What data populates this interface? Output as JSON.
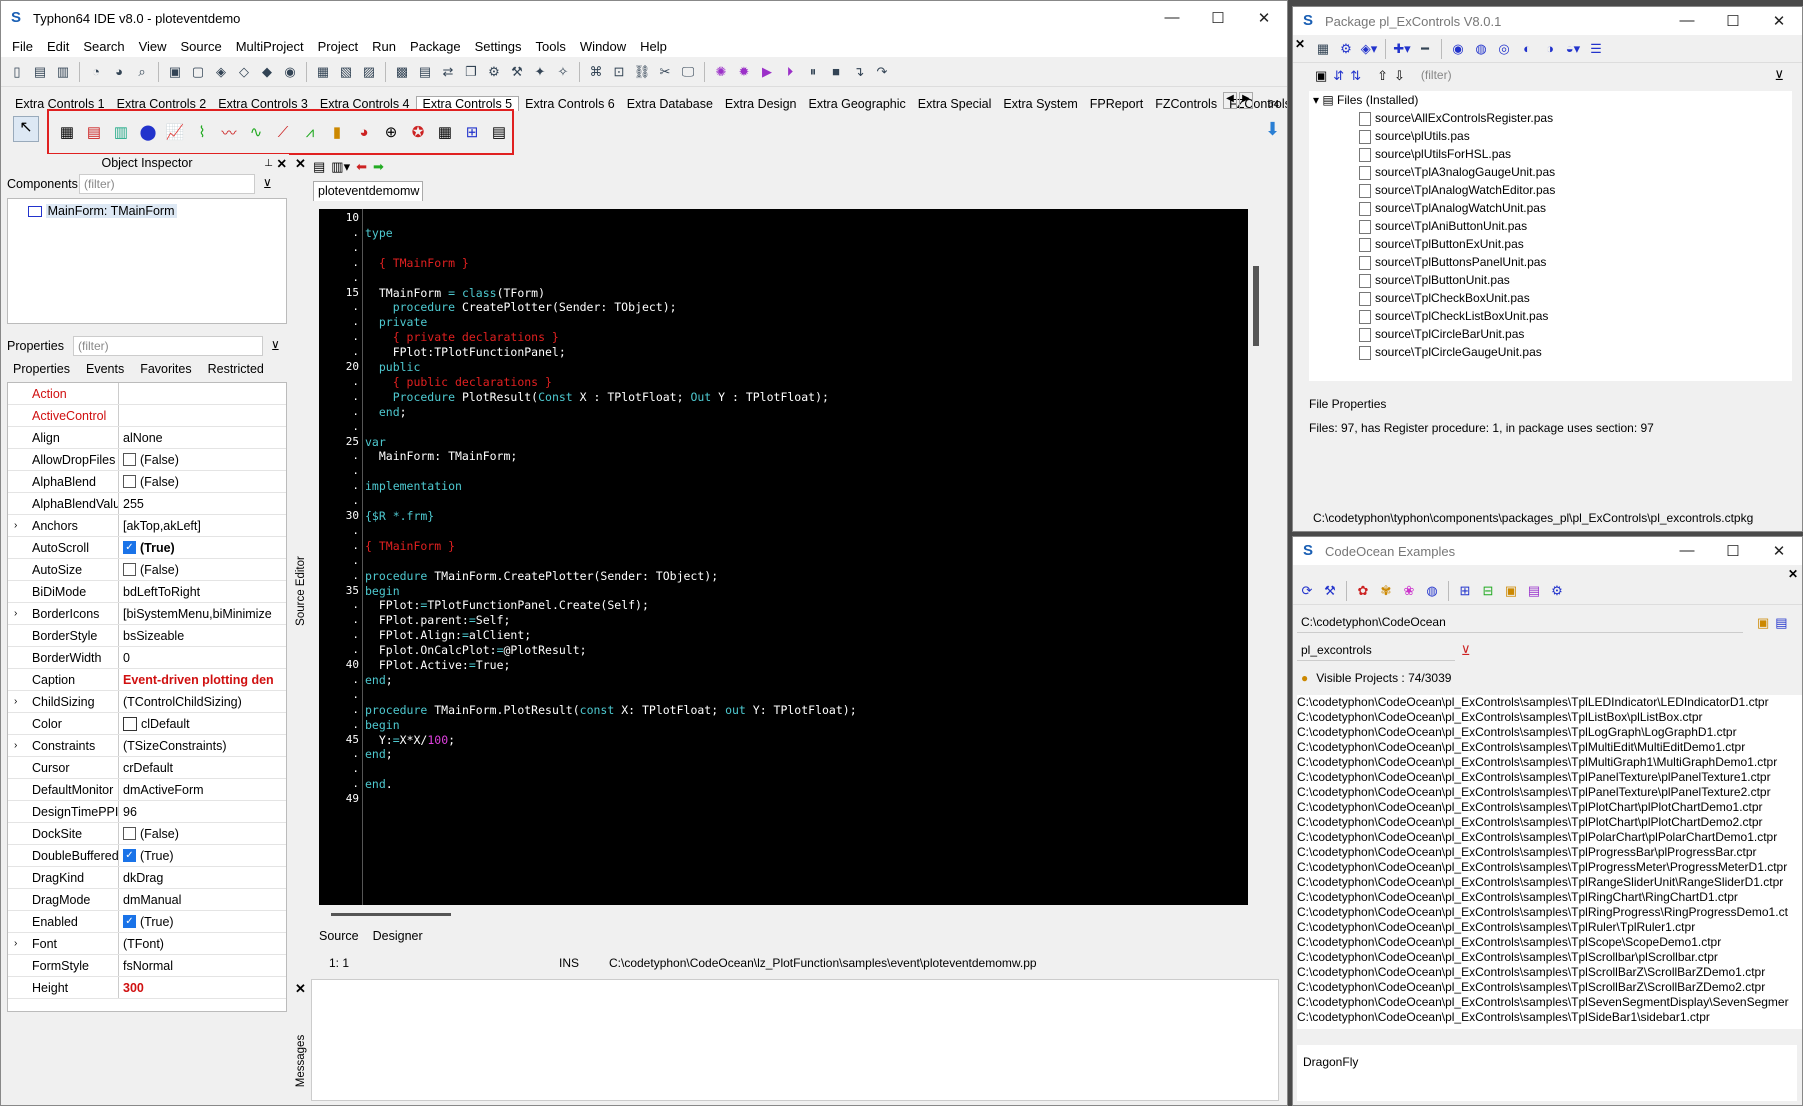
{
  "ide": {
    "title": "Typhon64 IDE v8.0 - ploteventdemo",
    "menu": [
      "File",
      "Edit",
      "Search",
      "View",
      "Source",
      "MultiProject",
      "Project",
      "Run",
      "Package",
      "Settings",
      "Tools",
      "Window",
      "Help"
    ],
    "palette_tabs": [
      "Extra Controls 1",
      "Extra Controls 2",
      "Extra Controls 3",
      "Extra Controls 4",
      "Extra Controls 5",
      "Extra Controls 6",
      "Extra Database",
      "Extra Design",
      "Extra Geographic",
      "Extra Special",
      "Extra System",
      "FPReport",
      "FZControls",
      "FZControls DB"
    ],
    "active_tab": "Extra Controls 5",
    "palette_count": "64"
  },
  "inspector": {
    "title": "Object Inspector",
    "components_label": "Components",
    "filter_placeholder": "(filter)",
    "tree_item": "MainForm: TMainForm",
    "properties_label": "Properties",
    "tabs": [
      "Properties",
      "Events",
      "Favorites",
      "Restricted"
    ],
    "rows": [
      {
        "name": "Action",
        "value": "",
        "red": true
      },
      {
        "name": "ActiveControl",
        "value": "",
        "red": true
      },
      {
        "name": "Align",
        "value": "alNone"
      },
      {
        "name": "AllowDropFiles",
        "value": "(False)",
        "chk": "off"
      },
      {
        "name": "AlphaBlend",
        "value": "(False)",
        "chk": "off"
      },
      {
        "name": "AlphaBlendValu",
        "value": "255"
      },
      {
        "name": "Anchors",
        "value": "[akTop,akLeft]",
        "exp": true
      },
      {
        "name": "AutoScroll",
        "value": "(True)",
        "chk": "on",
        "bold": true
      },
      {
        "name": "AutoSize",
        "value": "(False)",
        "chk": "off"
      },
      {
        "name": "BiDiMode",
        "value": "bdLeftToRight"
      },
      {
        "name": "BorderIcons",
        "value": "[biSystemMenu,biMinimize",
        "exp": true
      },
      {
        "name": "BorderStyle",
        "value": "bsSizeable"
      },
      {
        "name": "BorderWidth",
        "value": "0"
      },
      {
        "name": "Caption",
        "value": "Event-driven plotting den",
        "redval": true
      },
      {
        "name": "ChildSizing",
        "value": "(TControlChildSizing)",
        "exp": true
      },
      {
        "name": "Color",
        "value": "clDefault",
        "swatch": true
      },
      {
        "name": "Constraints",
        "value": "(TSizeConstraints)",
        "exp": true
      },
      {
        "name": "Cursor",
        "value": "crDefault"
      },
      {
        "name": "DefaultMonitor",
        "value": "dmActiveForm"
      },
      {
        "name": "DesignTimePPI",
        "value": "96"
      },
      {
        "name": "DockSite",
        "value": "(False)",
        "chk": "off"
      },
      {
        "name": "DoubleBuffered",
        "value": "(True)",
        "chk": "on"
      },
      {
        "name": "DragKind",
        "value": "dkDrag"
      },
      {
        "name": "DragMode",
        "value": "dmManual"
      },
      {
        "name": "Enabled",
        "value": "(True)",
        "chk": "on"
      },
      {
        "name": "Font",
        "value": "(TFont)",
        "exp": true
      },
      {
        "name": "FormStyle",
        "value": "fsNormal"
      },
      {
        "name": "Height",
        "value": "300",
        "redval": true
      }
    ]
  },
  "editor": {
    "tab": "ploteventdemomw",
    "side_label": "Source Editor",
    "bottom_tabs": [
      "Source",
      "Designer"
    ],
    "status_pos": "1:  1",
    "status_mode": "INS",
    "status_path": "C:\\codetyphon\\CodeOcean\\lz_PlotFunction\\samples\\event\\ploteventdemomw.pp",
    "messages_label": "Messages",
    "lines": [
      {
        "n": "10",
        "t": []
      },
      {
        "n": ".",
        "t": [
          [
            "kw",
            "type"
          ]
        ]
      },
      {
        "n": ".",
        "t": []
      },
      {
        "n": ".",
        "t": [
          [
            "cm",
            "  { TMainForm }"
          ]
        ]
      },
      {
        "n": ".",
        "t": []
      },
      {
        "n": "15",
        "t": [
          [
            "tx",
            "  TMainForm "
          ],
          [
            "kw",
            "= class"
          ],
          [
            "tx",
            "(TForm)"
          ]
        ]
      },
      {
        "n": ".",
        "t": [
          [
            "kw",
            "    procedure "
          ],
          [
            "tx",
            "CreatePlotter(Sender: TObject);"
          ]
        ]
      },
      {
        "n": ".",
        "t": [
          [
            "kw",
            "  private"
          ]
        ]
      },
      {
        "n": ".",
        "t": [
          [
            "cm",
            "    { private declarations }"
          ]
        ]
      },
      {
        "n": ".",
        "t": [
          [
            "tx",
            "    FPlot:TPlotFunctionPanel;"
          ]
        ]
      },
      {
        "n": "20",
        "t": [
          [
            "kw",
            "  public"
          ]
        ]
      },
      {
        "n": ".",
        "t": [
          [
            "cm",
            "    { public declarations }"
          ]
        ]
      },
      {
        "n": ".",
        "t": [
          [
            "kw",
            "    Procedure "
          ],
          [
            "tx",
            "PlotResult("
          ],
          [
            "kw",
            "Const "
          ],
          [
            "tx",
            "X : TPlotFloat; "
          ],
          [
            "kw",
            "Out "
          ],
          [
            "tx",
            "Y : TPlotFloat);"
          ]
        ]
      },
      {
        "n": ".",
        "t": [
          [
            "kw",
            "  end"
          ],
          [
            "tx",
            ";"
          ]
        ]
      },
      {
        "n": ".",
        "t": []
      },
      {
        "n": "25",
        "t": [
          [
            "kw",
            "var"
          ]
        ]
      },
      {
        "n": ".",
        "t": [
          [
            "tx",
            "  MainForm: TMainForm;"
          ]
        ]
      },
      {
        "n": ".",
        "t": []
      },
      {
        "n": ".",
        "t": [
          [
            "kw",
            "implementation"
          ]
        ]
      },
      {
        "n": ".",
        "t": []
      },
      {
        "n": "30",
        "t": [
          [
            "kw",
            "{$R *.frm}"
          ]
        ]
      },
      {
        "n": ".",
        "t": []
      },
      {
        "n": ".",
        "t": [
          [
            "cm",
            "{ TMainForm }"
          ]
        ]
      },
      {
        "n": ".",
        "t": []
      },
      {
        "n": ".",
        "t": [
          [
            "kw",
            "procedure "
          ],
          [
            "tx",
            "TMainForm.CreatePlotter(Sender: TObject);"
          ]
        ]
      },
      {
        "n": "35",
        "t": [
          [
            "kw",
            "begin"
          ]
        ]
      },
      {
        "n": ".",
        "t": [
          [
            "tx",
            "  FPlot:"
          ],
          [
            "kw",
            "="
          ],
          [
            "tx",
            "TPlotFunctionPanel.Create(Self);"
          ]
        ]
      },
      {
        "n": ".",
        "t": [
          [
            "tx",
            "  FPlot.parent:"
          ],
          [
            "kw",
            "="
          ],
          [
            "tx",
            "Self;"
          ]
        ]
      },
      {
        "n": ".",
        "t": [
          [
            "tx",
            "  FPlot.Align:"
          ],
          [
            "kw",
            "="
          ],
          [
            "tx",
            "alClient;"
          ]
        ]
      },
      {
        "n": ".",
        "t": [
          [
            "tx",
            "  Fplot.OnCalcPlot:"
          ],
          [
            "kw",
            "="
          ],
          [
            "tx",
            "@PlotResult;"
          ]
        ]
      },
      {
        "n": "40",
        "t": [
          [
            "tx",
            "  FPlot.Active:"
          ],
          [
            "kw",
            "="
          ],
          [
            "tx",
            "True;"
          ]
        ]
      },
      {
        "n": ".",
        "t": [
          [
            "kw",
            "end"
          ],
          [
            "tx",
            ";"
          ]
        ]
      },
      {
        "n": ".",
        "t": []
      },
      {
        "n": ".",
        "t": [
          [
            "kw",
            "procedure "
          ],
          [
            "tx",
            "TMainForm.PlotResult("
          ],
          [
            "kw",
            "const "
          ],
          [
            "tx",
            "X: TPlotFloat; "
          ],
          [
            "kw",
            "out "
          ],
          [
            "tx",
            "Y: TPlotFloat);"
          ]
        ]
      },
      {
        "n": ".",
        "t": [
          [
            "kw",
            "begin"
          ]
        ]
      },
      {
        "n": "45",
        "t": [
          [
            "tx",
            "  Y:"
          ],
          [
            "kw",
            "="
          ],
          [
            "tx",
            "X*X/"
          ],
          [
            "num",
            "100"
          ],
          [
            "tx",
            ";"
          ]
        ]
      },
      {
        "n": ".",
        "t": [
          [
            "kw",
            "end"
          ],
          [
            "tx",
            ";"
          ]
        ]
      },
      {
        "n": ".",
        "t": []
      },
      {
        "n": ".",
        "t": [
          [
            "kw",
            "end"
          ],
          [
            "tx",
            "."
          ]
        ]
      },
      {
        "n": "49",
        "t": []
      }
    ]
  },
  "package": {
    "title": "Package pl_ExControls V8.0.1",
    "filter_placeholder": "(filter)",
    "files_node": "Files  (Installed)",
    "files": [
      "source\\AllExControlsRegister.pas",
      "source\\plUtils.pas",
      "source\\plUtilsForHSL.pas",
      "source\\TplA3nalogGaugeUnit.pas",
      "source\\TplAnalogWatchEditor.pas",
      "source\\TplAnalogWatchUnit.pas",
      "source\\TplAniButtonUnit.pas",
      "source\\TplButtonExUnit.pas",
      "source\\TplButtonsPanelUnit.pas",
      "source\\TplButtonUnit.pas",
      "source\\TplCheckBoxUnit.pas",
      "source\\TplCheckListBoxUnit.pas",
      "source\\TplCircleBarUnit.pas",
      "source\\TplCircleGaugeUnit.pas"
    ],
    "props_label": "File Properties",
    "props_text": "Files: 97, has Register procedure: 1, in package uses section: 97",
    "path": "C:\\codetyphon\\typhon\\components\\packages_pl\\pl_ExControls\\pl_excontrols.ctpkg"
  },
  "ocean": {
    "title": "CodeOcean Examples",
    "path": "C:\\codetyphon\\CodeOcean",
    "filter": "pl_excontrols",
    "visible": "Visible Projects : 74/3039",
    "items": [
      "C:\\codetyphon\\CodeOcean\\pl_ExControls\\samples\\TplLEDIndicator\\LEDIndicatorD1.ctpr",
      "C:\\codetyphon\\CodeOcean\\pl_ExControls\\samples\\TplListBox\\plListBox.ctpr",
      "C:\\codetyphon\\CodeOcean\\pl_ExControls\\samples\\TplLogGraph\\LogGraphD1.ctpr",
      "C:\\codetyphon\\CodeOcean\\pl_ExControls\\samples\\TplMultiEdit\\MultiEditDemo1.ctpr",
      "C:\\codetyphon\\CodeOcean\\pl_ExControls\\samples\\TplMultiGraph1\\MultiGraphDemo1.ctpr",
      "C:\\codetyphon\\CodeOcean\\pl_ExControls\\samples\\TplPanelTexture\\plPanelTexture1.ctpr",
      "C:\\codetyphon\\CodeOcean\\pl_ExControls\\samples\\TplPanelTexture\\plPanelTexture2.ctpr",
      "C:\\codetyphon\\CodeOcean\\pl_ExControls\\samples\\TplPlotChart\\plPlotChartDemo1.ctpr",
      "C:\\codetyphon\\CodeOcean\\pl_ExControls\\samples\\TplPlotChart\\plPlotChartDemo2.ctpr",
      "C:\\codetyphon\\CodeOcean\\pl_ExControls\\samples\\TplPolarChart\\plPolarChartDemo1.ctpr",
      "C:\\codetyphon\\CodeOcean\\pl_ExControls\\samples\\TplProgressBar\\plProgressBar.ctpr",
      "C:\\codetyphon\\CodeOcean\\pl_ExControls\\samples\\TplProgressMeter\\ProgressMeterD1.ctpr",
      "C:\\codetyphon\\CodeOcean\\pl_ExControls\\samples\\TplRangeSliderUnit\\RangeSliderD1.ctpr",
      "C:\\codetyphon\\CodeOcean\\pl_ExControls\\samples\\TplRingChart\\RingChartD1.ctpr",
      "C:\\codetyphon\\CodeOcean\\pl_ExControls\\samples\\TplRingProgress\\RingProgressDemo1.ct",
      "C:\\codetyphon\\CodeOcean\\pl_ExControls\\samples\\TplRuler\\TplRuler1.ctpr",
      "C:\\codetyphon\\CodeOcean\\pl_ExControls\\samples\\TplScope\\ScopeDemo1.ctpr",
      "C:\\codetyphon\\CodeOcean\\pl_ExControls\\samples\\TplScrollbar\\plScrollbar.ctpr",
      "C:\\codetyphon\\CodeOcean\\pl_ExControls\\samples\\TplScrollBarZ\\ScrollBarZDemo1.ctpr",
      "C:\\codetyphon\\CodeOcean\\pl_ExControls\\samples\\TplScrollBarZ\\ScrollBarZDemo2.ctpr",
      "C:\\codetyphon\\CodeOcean\\pl_ExControls\\samples\\TplSevenSegmentDisplay\\SevenSegmer",
      "C:\\codetyphon\\CodeOcean\\pl_ExControls\\samples\\TplSideBar1\\sidebar1.ctpr"
    ],
    "bottom_text": "DragonFly"
  }
}
